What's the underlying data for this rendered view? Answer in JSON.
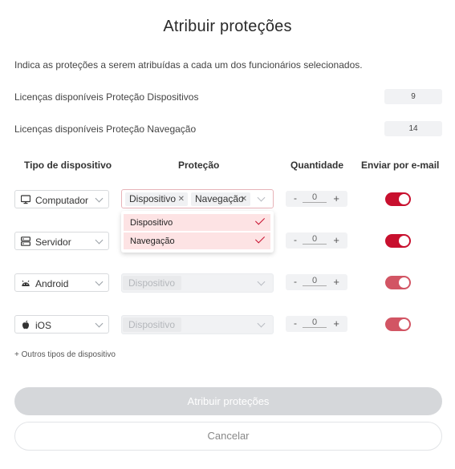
{
  "dialog": {
    "title": "Atribuir proteções",
    "description": "Indica as proteções a serem atribuídas a cada um dos funcionários selecionados."
  },
  "licenses": [
    {
      "label": "Licenças disponíveis Proteção Dispositivos",
      "value": "9"
    },
    {
      "label": "Licenças disponíveis Proteção Navegação",
      "value": "14"
    }
  ],
  "columns": {
    "device_type": "Tipo de dispositivo",
    "protection": "Proteção",
    "quantity": "Quantidade",
    "email": "Enviar por e-mail"
  },
  "rows": [
    {
      "device": "Computador",
      "icon": "monitor-icon",
      "protections": [
        "Dispositivo",
        "Navegação"
      ],
      "placeholder": "",
      "quantity_minus": "-",
      "quantity": "0",
      "quantity_plus": "+",
      "email_enabled": true
    },
    {
      "device": "Servidor",
      "icon": "server-icon",
      "protections": [],
      "placeholder": "",
      "quantity_minus": "-",
      "quantity": "0",
      "quantity_plus": "+",
      "email_enabled": true
    },
    {
      "device": "Android",
      "icon": "android-icon",
      "protections": [],
      "placeholder": "Dispositivo",
      "quantity_minus": "-",
      "quantity": "0",
      "quantity_plus": "+",
      "email_enabled": true
    },
    {
      "device": "iOS",
      "icon": "apple-icon",
      "protections": [],
      "placeholder": "Dispositivo",
      "quantity_minus": "-",
      "quantity": "0",
      "quantity_plus": "+",
      "email_enabled": true
    }
  ],
  "dropdown": {
    "options": [
      {
        "label": "Dispositivo",
        "selected": true
      },
      {
        "label": "Navegação",
        "selected": true
      }
    ]
  },
  "more_link": "+ Outros tipos de dispositivo",
  "buttons": {
    "assign": "Atribuir proteções",
    "cancel": "Cancelar"
  },
  "colors": {
    "accent": "#c8102e",
    "toggle_light": "#d25564",
    "dropdown_item_bg": "#fde3e4",
    "disabled_button": "#d5d7da"
  }
}
